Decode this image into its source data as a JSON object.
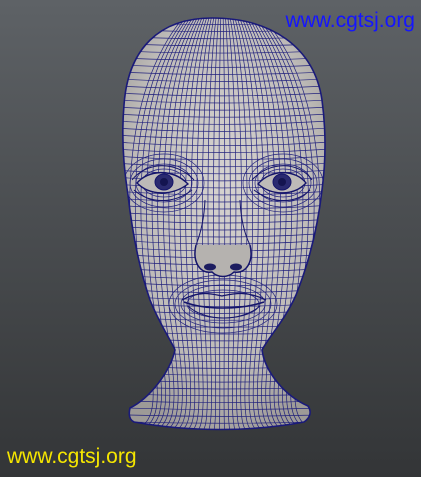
{
  "watermark_top": {
    "text": "www.cgtsj.org",
    "color": "#1515ff"
  },
  "watermark_bottom": {
    "text": "www.cgtsj.org",
    "color": "#f5e600"
  },
  "scene": {
    "subject": "wireframe-head-model",
    "surface_color": "#c7c4c1",
    "wire_color": "#1a1a7a",
    "background_top": "#5e6266",
    "background_bottom": "#333537"
  }
}
